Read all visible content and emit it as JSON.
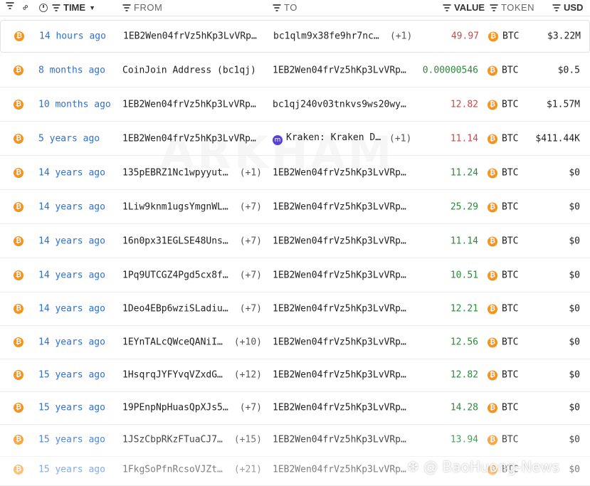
{
  "header": {
    "time": "TIME",
    "from": "FROM",
    "to": "TO",
    "value": "VALUE",
    "token": "TOKEN",
    "usd": "USD"
  },
  "rows": [
    {
      "time": "14 hours ago",
      "from": "1EB2Wen04frVz5hKp3LvVRp…",
      "from_more": "",
      "to": "bc1qlm9x38fe9hr7nc…",
      "to_more": "(+1)",
      "value": "49.97",
      "direction": "out",
      "token": "BTC",
      "usd": "$3.22M"
    },
    {
      "time": "8 months ago",
      "from": "CoinJoin Address (bc1qj)",
      "from_more": "",
      "to": "1EB2Wen04frVz5hKp3LvVRp…",
      "to_more": "",
      "value": "0.00000546",
      "direction": "in",
      "token": "BTC",
      "usd": "$0.5"
    },
    {
      "time": "10 months ago",
      "from": "1EB2Wen04frVz5hKp3LvVRp…",
      "from_more": "",
      "to": "bc1qj240v03tnkvs9ws20wy…",
      "to_more": "",
      "value": "12.82",
      "direction": "out",
      "token": "BTC",
      "usd": "$1.57M"
    },
    {
      "time": "5 years ago",
      "from": "1EB2Wen04frVz5hKp3LvVRp…",
      "from_more": "",
      "to": "Kraken: Kraken D…",
      "to_more": "(+1)",
      "to_entity": "kraken",
      "value": "11.14",
      "direction": "out",
      "token": "BTC",
      "usd": "$411.44K"
    },
    {
      "time": "14 years ago",
      "from": "135pEBRZ1Nc1wpyyut…",
      "from_more": "(+1)",
      "to": "1EB2Wen04frVz5hKp3LvVRp…",
      "to_more": "",
      "value": "11.24",
      "direction": "in",
      "token": "BTC",
      "usd": "$0"
    },
    {
      "time": "14 years ago",
      "from": "1Liw9knm1ugsYmgnWL…",
      "from_more": "(+7)",
      "to": "1EB2Wen04frVz5hKp3LvVRp…",
      "to_more": "",
      "value": "25.29",
      "direction": "in",
      "token": "BTC",
      "usd": "$0"
    },
    {
      "time": "14 years ago",
      "from": "16n0px31EGLSE48Uns…",
      "from_more": "(+7)",
      "to": "1EB2Wen04frVz5hKp3LvVRp…",
      "to_more": "",
      "value": "11.14",
      "direction": "in",
      "token": "BTC",
      "usd": "$0"
    },
    {
      "time": "14 years ago",
      "from": "1Pq9UTCGZ4Pgd5cx8f…",
      "from_more": "(+7)",
      "to": "1EB2Wen04frVz5hKp3LvVRp…",
      "to_more": "",
      "value": "10.51",
      "direction": "in",
      "token": "BTC",
      "usd": "$0"
    },
    {
      "time": "14 years ago",
      "from": "1Deo4EBp6wziSLadiu…",
      "from_more": "(+7)",
      "to": "1EB2Wen04frVz5hKp3LvVRp…",
      "to_more": "",
      "value": "12.21",
      "direction": "in",
      "token": "BTC",
      "usd": "$0"
    },
    {
      "time": "14 years ago",
      "from": "1EYnTALcQWceQANiI…",
      "from_more": "(+10)",
      "to": "1EB2Wen04frVz5hKp3LvVRp…",
      "to_more": "",
      "value": "12.56",
      "direction": "in",
      "token": "BTC",
      "usd": "$0"
    },
    {
      "time": "15 years ago",
      "from": "1HsqrqJYFYvqVZxdG…",
      "from_more": "(+12)",
      "to": "1EB2Wen04frVz5hKp3LvVRp…",
      "to_more": "",
      "value": "12.82",
      "direction": "in",
      "token": "BTC",
      "usd": "$0"
    },
    {
      "time": "15 years ago",
      "from": "19PEnpNpHuasQpXJs5…",
      "from_more": "(+7)",
      "to": "1EB2Wen04frVz5hKp3LvVRp…",
      "to_more": "",
      "value": "14.28",
      "direction": "in",
      "token": "BTC",
      "usd": "$0"
    },
    {
      "time": "15 years ago",
      "from": "1JSzCbpRKzFTuaCJ7…",
      "from_more": "(+15)",
      "to": "1EB2Wen04frVz5hKp3LvVRp…",
      "to_more": "",
      "value": "13.94",
      "direction": "in",
      "token": "BTC",
      "usd": "$0"
    },
    {
      "time": "15 years ago",
      "from": "1FkgSoPfnRcsoVJZt…",
      "from_more": "(+21)",
      "to": "1EB2Wen04frVz5hKp3LvVRp…",
      "to_more": "",
      "value": "",
      "direction": "in",
      "token": "BTC",
      "usd": "$0"
    }
  ],
  "watermarks": {
    "brand": "ARKHAM",
    "news": "BaoHuong-News"
  },
  "colors": {
    "inflow": "#2a8a3a",
    "outflow": "#d24444",
    "time_link": "#2c6fd6",
    "btc": "#f7931a",
    "kraken": "#5841d8"
  },
  "icons": {
    "token": "btc-icon",
    "filter": "filter-icon",
    "link": "link-icon",
    "clock": "clock-icon"
  }
}
